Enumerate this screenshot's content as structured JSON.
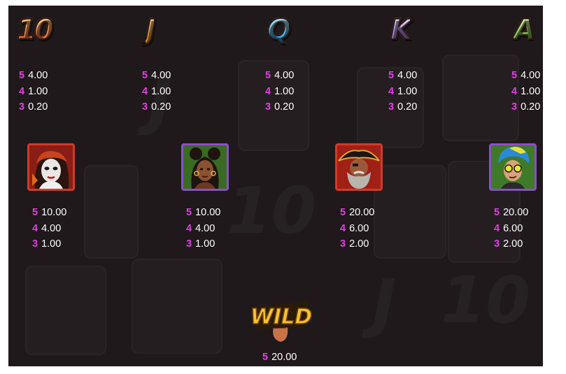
{
  "paytable": {
    "symbols": [
      {
        "id": "10",
        "glyph": "10",
        "icon": "ten-symbol-icon",
        "pays": [
          {
            "count": "5",
            "value": "4.00"
          },
          {
            "count": "4",
            "value": "1.00"
          },
          {
            "count": "3",
            "value": "0.20"
          }
        ]
      },
      {
        "id": "j",
        "glyph": "J",
        "icon": "j-symbol-icon",
        "pays": [
          {
            "count": "5",
            "value": "4.00"
          },
          {
            "count": "4",
            "value": "1.00"
          },
          {
            "count": "3",
            "value": "0.20"
          }
        ]
      },
      {
        "id": "q",
        "glyph": "Q",
        "icon": "q-symbol-icon",
        "pays": [
          {
            "count": "5",
            "value": "4.00"
          },
          {
            "count": "4",
            "value": "1.00"
          },
          {
            "count": "3",
            "value": "0.20"
          }
        ]
      },
      {
        "id": "k",
        "glyph": "K",
        "icon": "k-symbol-icon",
        "pays": [
          {
            "count": "5",
            "value": "4.00"
          },
          {
            "count": "4",
            "value": "1.00"
          },
          {
            "count": "3",
            "value": "0.20"
          }
        ]
      },
      {
        "id": "a",
        "glyph": "A",
        "icon": "a-symbol-icon",
        "pays": [
          {
            "count": "5",
            "value": "4.00"
          },
          {
            "count": "4",
            "value": "1.00"
          },
          {
            "count": "3",
            "value": "0.20"
          }
        ]
      },
      {
        "id": "mime-woman",
        "icon": "mime-woman-portrait-icon",
        "frame_color": "#d23a2a",
        "pays": [
          {
            "count": "5",
            "value": "10.00"
          },
          {
            "count": "4",
            "value": "4.00"
          },
          {
            "count": "3",
            "value": "1.00"
          }
        ]
      },
      {
        "id": "braided-woman",
        "icon": "braided-woman-portrait-icon",
        "frame_color": "#8a4fc8",
        "pays": [
          {
            "count": "5",
            "value": "10.00"
          },
          {
            "count": "4",
            "value": "4.00"
          },
          {
            "count": "3",
            "value": "1.00"
          }
        ]
      },
      {
        "id": "pirate",
        "icon": "pirate-portrait-icon",
        "frame_color": "#d23a2a",
        "pays": [
          {
            "count": "5",
            "value": "20.00"
          },
          {
            "count": "4",
            "value": "6.00"
          },
          {
            "count": "3",
            "value": "2.00"
          }
        ]
      },
      {
        "id": "punk-glasses",
        "icon": "punk-glasses-portrait-icon",
        "frame_color": "#8a4fc8",
        "pays": [
          {
            "count": "5",
            "value": "20.00"
          },
          {
            "count": "4",
            "value": "6.00"
          },
          {
            "count": "3",
            "value": "2.00"
          }
        ]
      },
      {
        "id": "wild",
        "glyph": "WILD",
        "icon": "wild-symbol-icon",
        "pays": [
          {
            "count": "5",
            "value": "20.00"
          }
        ]
      }
    ]
  },
  "colors": {
    "background": "#1f191b",
    "count_accent": "#e040e0",
    "value_text": "#ffffff"
  }
}
